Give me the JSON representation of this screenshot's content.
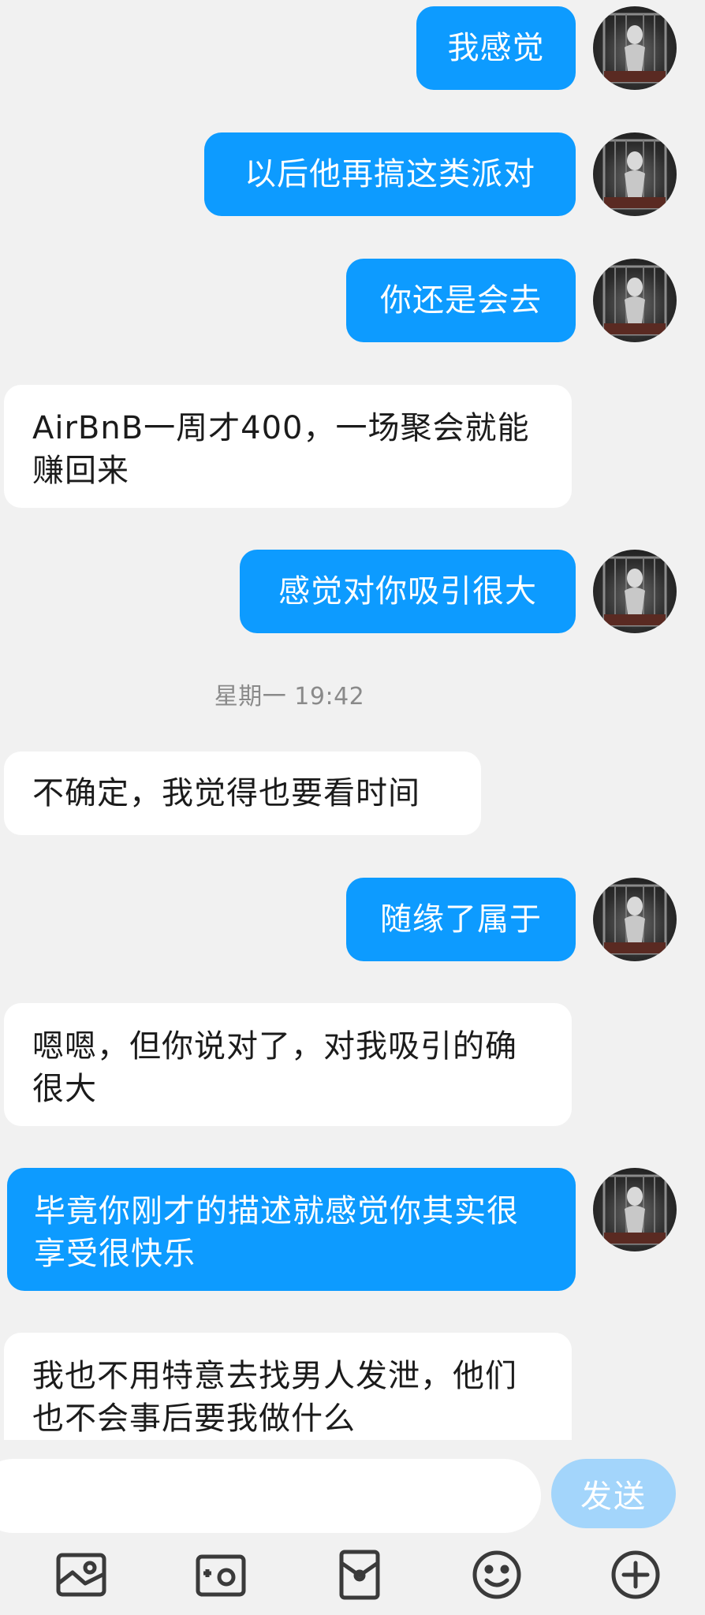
{
  "messages": [
    {
      "dir": "out",
      "text": "我感觉"
    },
    {
      "dir": "out",
      "text": "以后他再搞这类派对"
    },
    {
      "dir": "out",
      "text": "你还是会去"
    },
    {
      "dir": "in",
      "text": "AirBnB一周才400，一场聚会就能赚回来"
    },
    {
      "dir": "out",
      "text": "感觉对你吸引很大"
    },
    {
      "dir": "in",
      "text": "不确定，我觉得也要看时间"
    },
    {
      "dir": "out",
      "text": "随缘了属于"
    },
    {
      "dir": "in",
      "text": "嗯嗯，但你说对了，对我吸引的确很大"
    },
    {
      "dir": "out",
      "text": "毕竟你刚才的描述就感觉你其实很享受很快乐"
    },
    {
      "dir": "in",
      "text": "我也不用特意去找男人发泄，他们也不会事后要我做什么"
    }
  ],
  "timestamp": "星期一 19:42",
  "composer": {
    "input_value": "",
    "send_label": "发送"
  },
  "toolbar": [
    "image-icon",
    "camera-icon",
    "red-packet-icon",
    "emoji-icon",
    "plus-icon"
  ],
  "colors": {
    "outgoing_bubble": "#0d9bff",
    "incoming_bubble": "#ffffff",
    "background": "#f1f1f1",
    "send_button": "#a3d5fb"
  }
}
